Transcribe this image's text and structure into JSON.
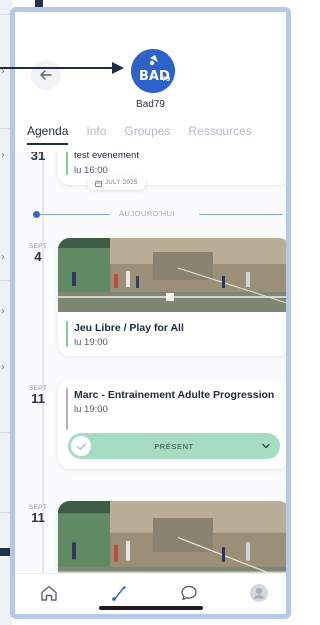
{
  "header": {
    "club_name": "Bad79",
    "logo_text": "BAD",
    "logo_number": "79"
  },
  "tabs": [
    {
      "label": "Agenda",
      "active": true
    },
    {
      "label": "Info",
      "active": false
    },
    {
      "label": "Groupes",
      "active": false
    },
    {
      "label": "Ressources",
      "active": false
    }
  ],
  "events": [
    {
      "month": "",
      "day": "31",
      "title": "test événement",
      "time": "lu 16:00",
      "bar_color": "#7fd08e"
    },
    {
      "month": "SEPT",
      "day": "4",
      "title": "Jeu Libre / Play for All",
      "time": "lu 19:00",
      "bar_color": "#7fd08e",
      "has_photo": true
    },
    {
      "month": "SEPT",
      "day": "11",
      "title": "Marc - Entrainement Adulte Progression",
      "time": "lu 19:00",
      "bar_color": "#b7a7d9",
      "presence": "PRÉSENT"
    },
    {
      "month": "SEPT",
      "day": "11",
      "title": "",
      "time": "",
      "has_photo": true
    }
  ],
  "month_pill": "JULY 2025",
  "today_label": "AUJOURD'HUI",
  "nav": [
    "home-icon",
    "shuttlecock-icon",
    "chat-icon",
    "profile-icon"
  ],
  "colors": {
    "frame": "#b7c7e6",
    "accent": "#2d63c8",
    "presence_bg": "#a6dcc2",
    "deco": "#23324a"
  }
}
